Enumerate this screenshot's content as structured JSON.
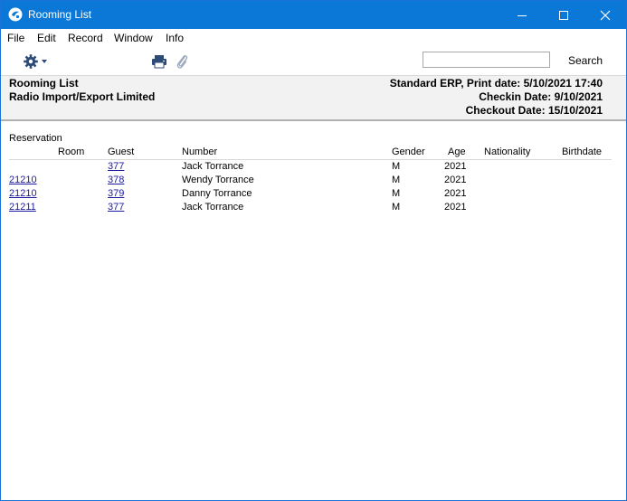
{
  "window": {
    "title": "Rooming List",
    "colors": {
      "titlebar": "#0b78d7",
      "header_bg": "#f2f2f2",
      "link": "#1a1a9c"
    }
  },
  "menu": [
    "File",
    "Edit",
    "Record",
    "Window",
    "Info"
  ],
  "toolbar": {
    "search_placeholder": "",
    "search_value": "",
    "search_label": "Search",
    "icons": [
      "gear-icon",
      "chevron-down-icon",
      "print-icon",
      "paperclip-icon"
    ]
  },
  "report": {
    "title": "Rooming List",
    "company": "Radio Import/Export Limited",
    "print_info": "Standard ERP, Print date: 5/10/2021 17:40",
    "checkin": "Checkin Date: 9/10/2021",
    "checkout": "Checkout Date: 15/10/2021"
  },
  "table": {
    "section": "Reservation",
    "headers": {
      "room": "Room",
      "guest": "Guest",
      "number": "Number",
      "gender": "Gender",
      "age": "Age",
      "nationality": "Nationality",
      "birthdate": "Birthdate"
    },
    "rows": [
      {
        "reservation": "",
        "guest": "377",
        "name": "Jack Torrance",
        "gender": "M",
        "age": "2021",
        "nationality": "",
        "birthdate": ""
      },
      {
        "reservation": "21210",
        "guest": "378",
        "name": "Wendy Torrance",
        "gender": "M",
        "age": "2021",
        "nationality": "",
        "birthdate": ""
      },
      {
        "reservation": "21210",
        "guest": "379",
        "name": "Danny Torrance",
        "gender": "M",
        "age": "2021",
        "nationality": "",
        "birthdate": ""
      },
      {
        "reservation": "21211",
        "guest": "377",
        "name": "Jack Torrance",
        "gender": "M",
        "age": "2021",
        "nationality": "",
        "birthdate": ""
      }
    ]
  }
}
